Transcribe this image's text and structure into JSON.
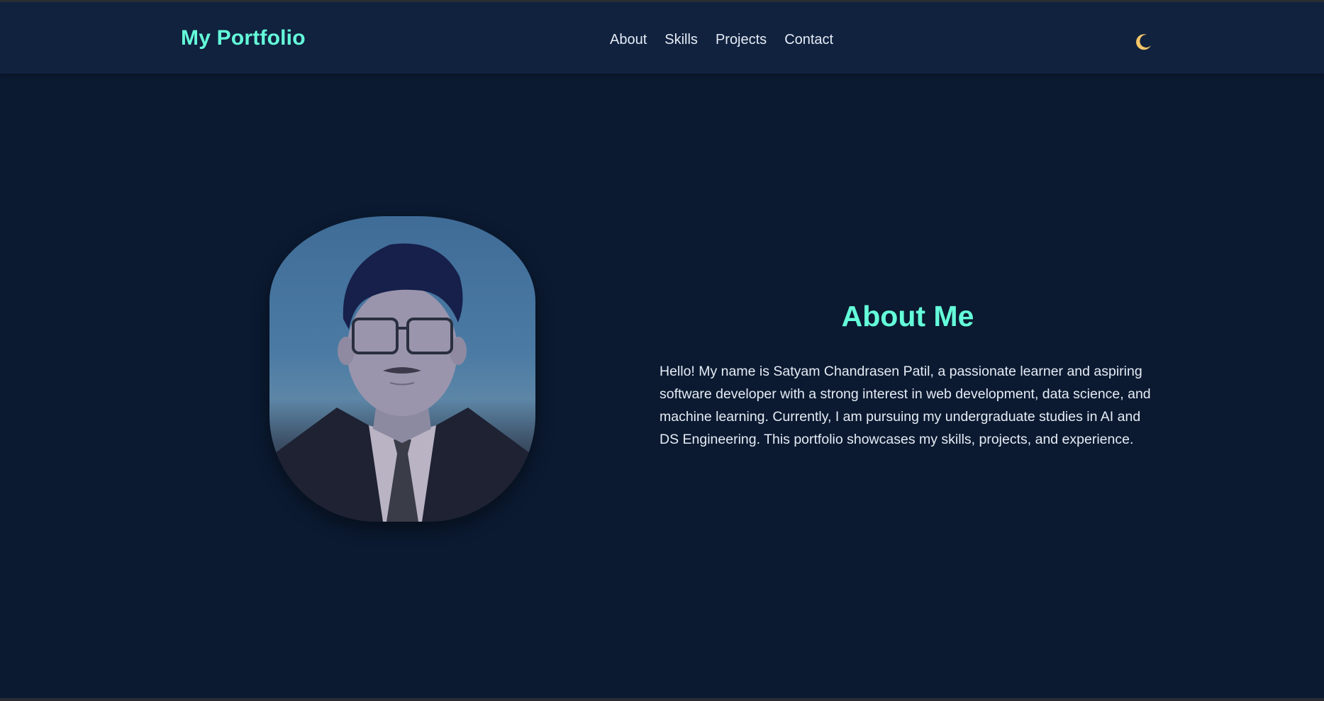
{
  "navbar": {
    "brand": "My Portfolio",
    "links": [
      {
        "label": "About"
      },
      {
        "label": "Skills"
      },
      {
        "label": "Projects"
      },
      {
        "label": "Contact"
      }
    ],
    "theme_toggle_icon": "moon-icon"
  },
  "about": {
    "title": "About Me",
    "text": "Hello! My name is Satyam Chandrasen Patil, a passionate learner and aspiring software developer with a strong interest in web development, data science, and machine learning. Currently, I am pursuing my undergraduate studies in AI and DS Engineering. This portfolio showcases my skills, projects, and experience.",
    "photo_icon": "profile-photo"
  },
  "colors": {
    "accent": "#64ffda",
    "background": "#0b1a31",
    "navbar": "#11223f",
    "text": "#e6ecf5",
    "moon": "#f6c667"
  }
}
